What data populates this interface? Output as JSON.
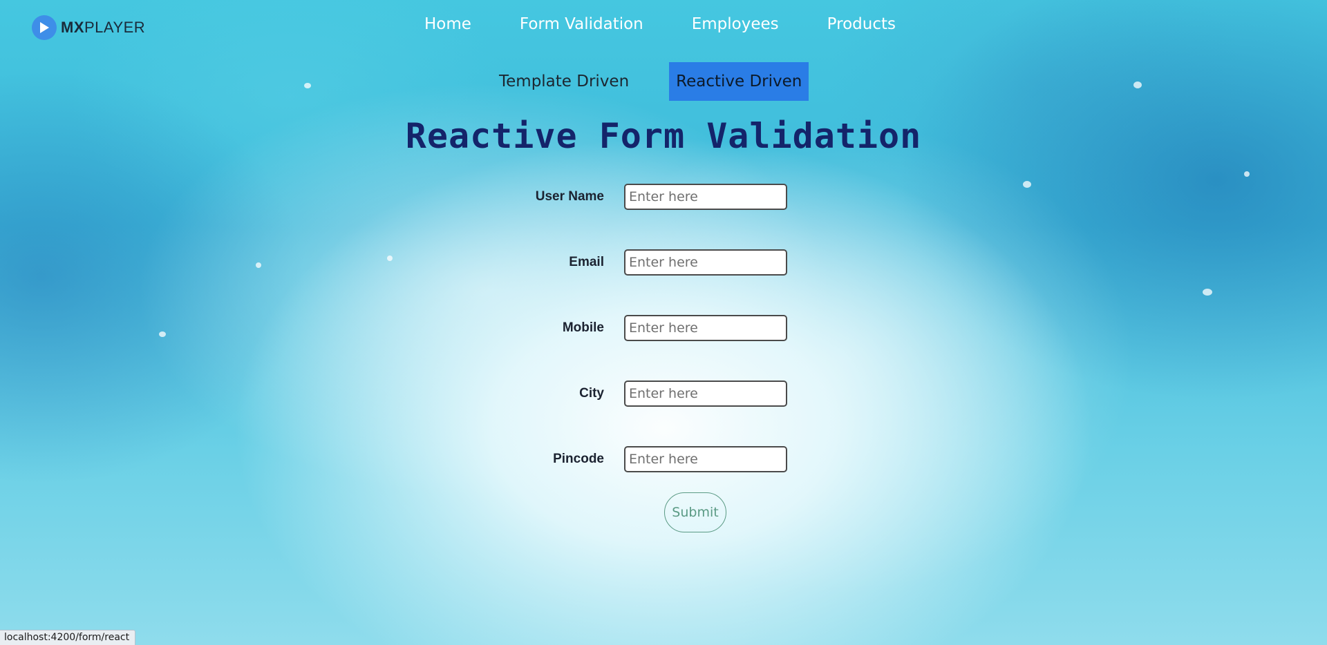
{
  "brand": {
    "name_bold": "MX",
    "name_rest": "PLAYER"
  },
  "nav": {
    "items": [
      {
        "label": "Home"
      },
      {
        "label": "Form Validation"
      },
      {
        "label": "Employees"
      },
      {
        "label": "Products"
      }
    ]
  },
  "subnav": {
    "items": [
      {
        "label": "Template Driven",
        "active": false
      },
      {
        "label": "Reactive Driven",
        "active": true
      }
    ],
    "active_color": "#2a7de6"
  },
  "page": {
    "title": "Reactive Form Validation"
  },
  "form": {
    "fields": [
      {
        "label": "User Name",
        "value": "",
        "placeholder": "Enter here"
      },
      {
        "label": "Email",
        "value": "",
        "placeholder": "Enter here"
      },
      {
        "label": "Mobile",
        "value": "",
        "placeholder": "Enter here"
      },
      {
        "label": "City",
        "value": "",
        "placeholder": "Enter here"
      },
      {
        "label": "Pincode",
        "value": "",
        "placeholder": "Enter here"
      }
    ],
    "submit_label": "Submit"
  },
  "status_bar": {
    "url": "localhost:4200/form/react"
  },
  "colors": {
    "title": "#14246a",
    "logo_accent": "#3e8ee8",
    "submit": "#5a9a84"
  },
  "icons": {
    "logo": "play-icon"
  }
}
